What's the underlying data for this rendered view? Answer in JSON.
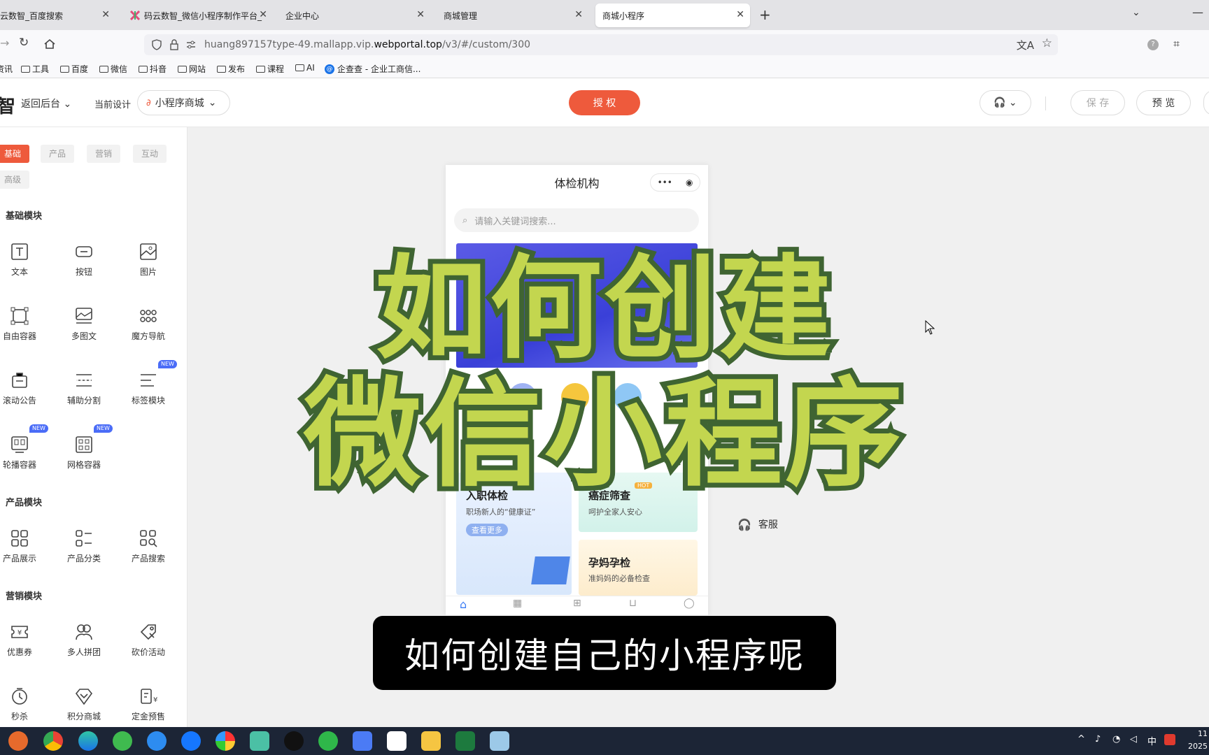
{
  "browser": {
    "tabs": [
      {
        "title": "云数智_百度搜索"
      },
      {
        "title": "码云数智_微信小程序制作平台_"
      },
      {
        "title": "企业中心"
      },
      {
        "title": "商城管理"
      },
      {
        "title": "商城小程序"
      }
    ],
    "new_tab": "+",
    "url_prefix": "huang897157type-49.mallapp.vip.",
    "url_domain": "webportal.top",
    "url_path": "/v3/#/custom/300",
    "bookmarks": [
      "资讯",
      "工具",
      "百度",
      "微信",
      "抖音",
      "网站",
      "发布",
      "课程",
      "AI",
      "企查查 - 企业工商信..."
    ]
  },
  "header": {
    "logo": "智",
    "back_label": "返回后台",
    "current_design_label": "当前设计",
    "design_select": "小程序商城",
    "authorize_label": "授 权",
    "save_label": "保 存",
    "preview_label": "预 览",
    "accent": "#ee5a3c"
  },
  "sidebar": {
    "tabs": [
      "基础",
      "产品",
      "营销",
      "互动",
      "高级"
    ],
    "sections": [
      {
        "title": "基础模块",
        "items": [
          {
            "label": "文本",
            "icon": "text-icon"
          },
          {
            "label": "按钮",
            "icon": "button-icon"
          },
          {
            "label": "图片",
            "icon": "image-icon"
          },
          {
            "label": "自由容器",
            "icon": "free-container-icon"
          },
          {
            "label": "多图文",
            "icon": "multi-image-icon"
          },
          {
            "label": "魔方导航",
            "icon": "cube-nav-icon"
          },
          {
            "label": "滚动公告",
            "icon": "notice-icon"
          },
          {
            "label": "辅助分割",
            "icon": "divider-icon"
          },
          {
            "label": "标签模块",
            "icon": "tag-icon",
            "badge": "NEW"
          },
          {
            "label": "轮播容器",
            "icon": "carousel-icon",
            "badge": "NEW"
          },
          {
            "label": "网格容器",
            "icon": "grid-icon",
            "badge": "NEW"
          }
        ]
      },
      {
        "title": "产品模块",
        "items": [
          {
            "label": "产品展示",
            "icon": "product-show-icon"
          },
          {
            "label": "产品分类",
            "icon": "product-category-icon"
          },
          {
            "label": "产品搜索",
            "icon": "product-search-icon"
          }
        ]
      },
      {
        "title": "营销模块",
        "items": [
          {
            "label": "优惠券",
            "icon": "coupon-icon"
          },
          {
            "label": "多人拼团",
            "icon": "group-buy-icon"
          },
          {
            "label": "砍价活动",
            "icon": "bargain-icon"
          },
          {
            "label": "秒杀",
            "icon": "flash-sale-icon"
          },
          {
            "label": "积分商城",
            "icon": "points-mall-icon"
          },
          {
            "label": "定金预售",
            "icon": "presale-icon"
          }
        ]
      }
    ]
  },
  "phone": {
    "title": "体检机构",
    "search_placeholder": "请输入关键词搜索...",
    "card1_title": "入职体检",
    "card1_sub": "职场新人的“健康证”",
    "card1_btn": "查看更多",
    "card2_title": "癌症筛查",
    "card2_sub": "呵护全家人安心",
    "card2_badge": "HOT",
    "card3_title": "孕妈孕检",
    "card3_sub": "准妈妈的必备检查",
    "side_label": "客服"
  },
  "overlay": {
    "line1": "如何创建",
    "line2": "微信小程序",
    "subtitle": "如何创建自己的小程序呢"
  },
  "taskbar": {
    "tray_lang": "中",
    "clock_time": "11",
    "clock_date": "2025"
  }
}
